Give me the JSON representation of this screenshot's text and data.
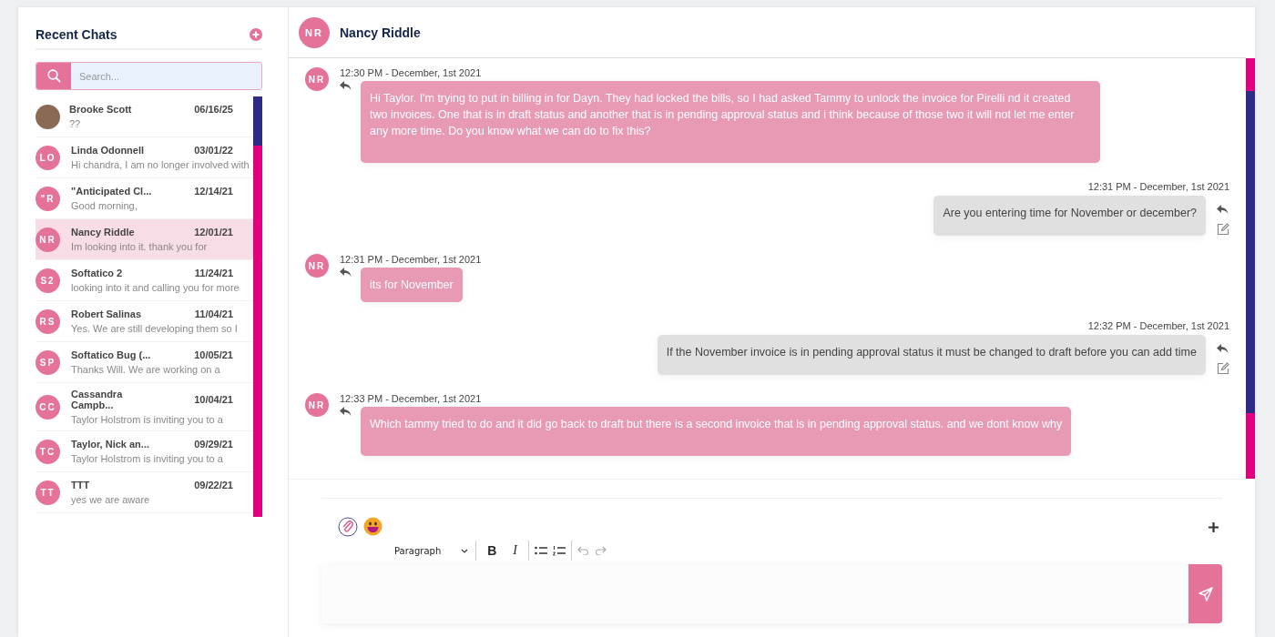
{
  "sidebar": {
    "title": "Recent Chats",
    "search": {
      "placeholder": "Search..."
    },
    "chats": [
      {
        "kind": "photo",
        "name": "Brooke Scott",
        "date": "06/16/25",
        "preview": "??",
        "selected": false
      },
      {
        "kind": "initials",
        "initials": "LO",
        "name": "Linda Odonnell",
        "date": "03/01/22",
        "preview": "Hi chandra, I am no longer involved with",
        "selected": false
      },
      {
        "kind": "initials",
        "initials": "\"R",
        "name": "\"Anticipated Cl...",
        "date": "12/14/21",
        "preview": "Good morning,",
        "selected": false
      },
      {
        "kind": "initials",
        "initials": "NR",
        "name": "Nancy Riddle",
        "date": "12/01/21",
        "preview": "Im looking into it. thank you for",
        "selected": true
      },
      {
        "kind": "initials",
        "initials": "S2",
        "name": "Softatico 2",
        "date": "11/24/21",
        "preview": "looking into it and calling you for more",
        "selected": false
      },
      {
        "kind": "initials",
        "initials": "RS",
        "name": "Robert Salinas",
        "date": "11/04/21",
        "preview": "Yes. We are still developing them so I",
        "selected": false
      },
      {
        "kind": "initials",
        "initials": "SP",
        "name": "Softatico Bug (...",
        "date": "10/05/21",
        "preview": "Thanks Will. We are working on a",
        "selected": false
      },
      {
        "kind": "initials",
        "initials": "CC",
        "name": "Cassandra Campb...",
        "date": "10/04/21",
        "preview": "Taylor Holstrom is inviting you to a",
        "selected": false
      },
      {
        "kind": "initials",
        "initials": "TC",
        "name": "Taylor, Nick an...",
        "date": "09/29/21",
        "preview": "Taylor Holstrom is inviting you to a",
        "selected": false
      },
      {
        "kind": "initials",
        "initials": "TT",
        "name": "TTT",
        "date": "09/22/21",
        "preview": "yes we are aware",
        "selected": false
      }
    ]
  },
  "conversation": {
    "initials": "NR",
    "name": "Nancy Riddle",
    "messages": [
      {
        "kind": "received",
        "initials": "NR",
        "time": "12:30 PM - December, 1st 2021",
        "text": "Hi Taylor. I'm trying to put in billing in for Dayn. They had locked the bills, so I had asked Tammy to unlock the invoice for Pirelli nd it created two invoices. One that is in draft status and another that is in pending approval status and i think because of those two it will not let me enter any more time. Do you know what we can do to fix this?"
      },
      {
        "kind": "sent",
        "time": "12:31 PM - December, 1st 2021",
        "text": "Are you entering time for November or december?"
      },
      {
        "kind": "received",
        "initials": "NR",
        "time": "12:31 PM - December, 1st 2021",
        "text": "its for November"
      },
      {
        "kind": "sent",
        "time": "12:32 PM - December, 1st 2021",
        "text": "If the November invoice is in pending approval status it must be changed to draft before you can add time"
      },
      {
        "kind": "received",
        "initials": "NR",
        "time": "12:33 PM - December, 1st 2021",
        "text": "Which  tammy tried to do and it did  go back to draft but there is a second invoice that is in pending approval status. and we dont know why"
      }
    ]
  },
  "composer": {
    "format": "Paragraph",
    "bold_label": "B",
    "italic_label": "I"
  }
}
